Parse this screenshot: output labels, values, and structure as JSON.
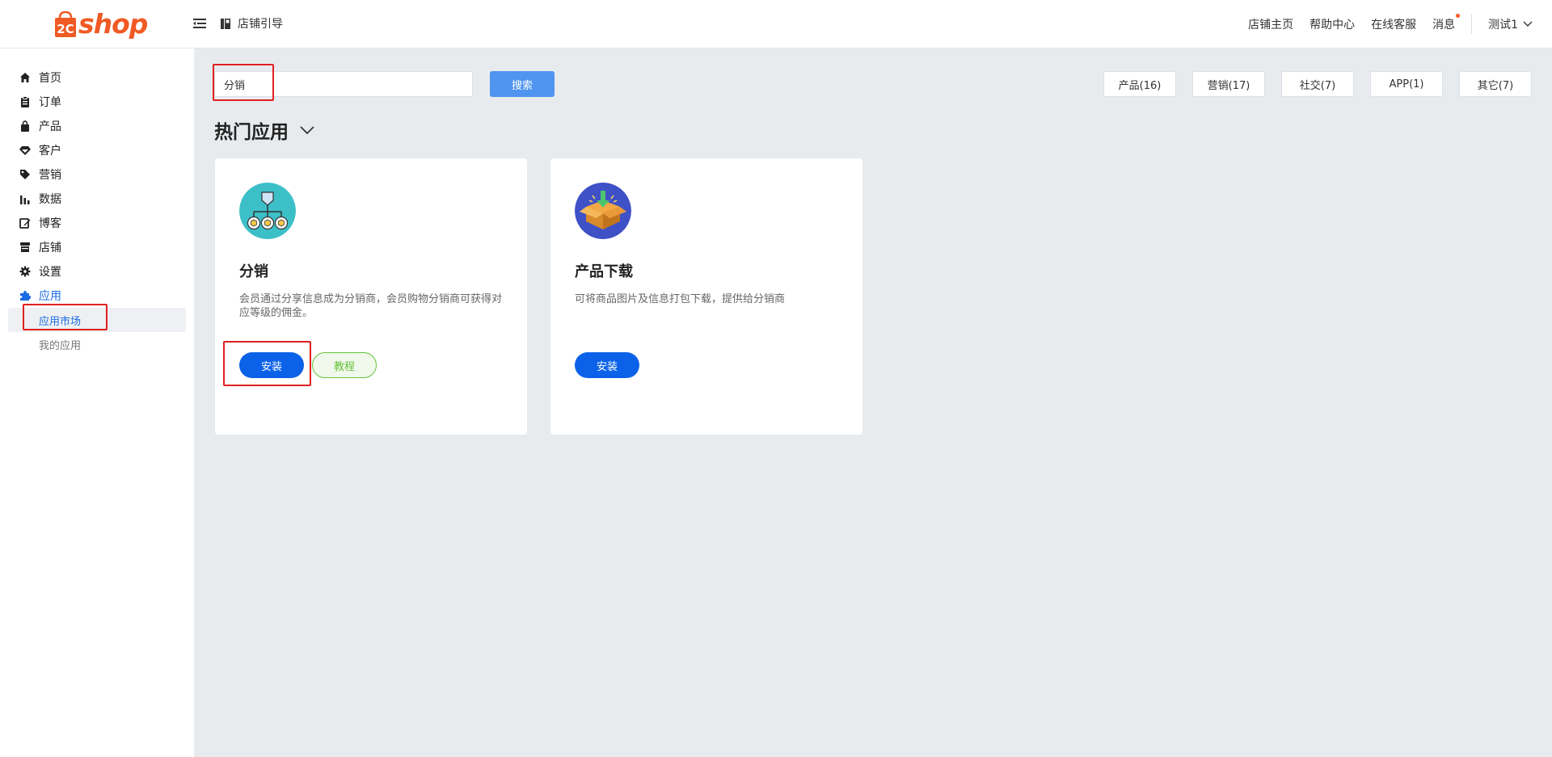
{
  "header": {
    "logo_text": "shop",
    "logo_mark_text": "2C",
    "guide_label": "店铺引导",
    "links": [
      "店铺主页",
      "帮助中心",
      "在线客服",
      "消息"
    ],
    "user_name": "测试1",
    "colors": {
      "brand": "#f05a24",
      "accent": "#1b6ce3"
    }
  },
  "sidebar": {
    "items": [
      {
        "label": "首页",
        "icon": "home-icon"
      },
      {
        "label": "订单",
        "icon": "clipboard-icon"
      },
      {
        "label": "产品",
        "icon": "bag-icon"
      },
      {
        "label": "客户",
        "icon": "gem-icon"
      },
      {
        "label": "营销",
        "icon": "tag-icon"
      },
      {
        "label": "数据",
        "icon": "bar-chart-icon"
      },
      {
        "label": "博客",
        "icon": "edit-icon"
      },
      {
        "label": "店铺",
        "icon": "store-icon"
      },
      {
        "label": "设置",
        "icon": "gear-icon"
      },
      {
        "label": "应用",
        "icon": "puzzle-icon"
      }
    ],
    "sub_items": [
      {
        "label": "应用市场"
      },
      {
        "label": "我的应用"
      }
    ]
  },
  "search": {
    "value": "分销",
    "button_label": "搜索"
  },
  "filters": [
    "产品(16)",
    "营销(17)",
    "社交(7)",
    "APP(1)",
    "其它(7)"
  ],
  "section_title": "热门应用",
  "cards": [
    {
      "title": "分销",
      "description": "会员通过分享信息成为分销商，会员购物分销商可获得对应等级的佣金。",
      "install_label": "安装",
      "tutorial_label": "教程",
      "icon": "distribution-icon"
    },
    {
      "title": "产品下载",
      "description": "可将商品图片及信息打包下载，提供给分销商",
      "install_label": "安装",
      "icon": "download-box-icon"
    }
  ]
}
